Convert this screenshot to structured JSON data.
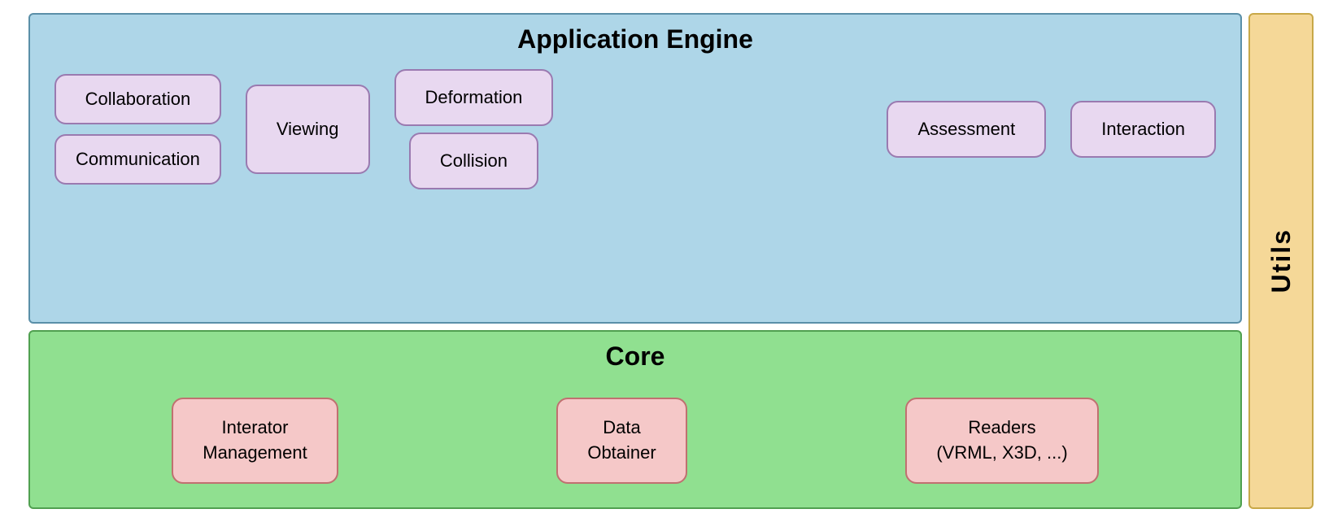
{
  "appEngine": {
    "title": "Application Engine",
    "modules": {
      "collaboration": "Collaboration",
      "communication": "Communication",
      "viewing": "Viewing",
      "deformation": "Deformation",
      "collision": "Collision",
      "assessment": "Assessment",
      "interaction": "Interaction"
    }
  },
  "core": {
    "title": "Core",
    "modules": {
      "interatorManagement": "Interator\nManagement",
      "dataObtainer": "Data\nObtainer",
      "readers": "Readers\n(VRML, X3D, ...)"
    }
  },
  "utils": {
    "label": "Utils"
  }
}
